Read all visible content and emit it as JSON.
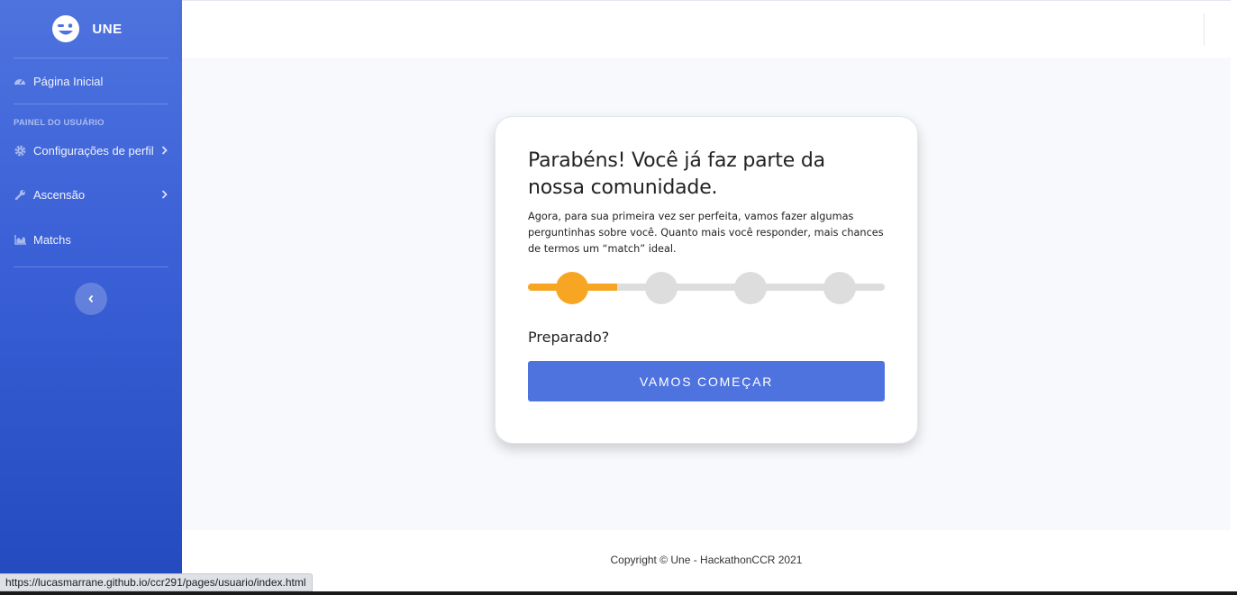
{
  "brand": {
    "name": "UNE",
    "logo_icon": "winking-face-icon"
  },
  "sidebar": {
    "home": {
      "label": "Página Inicial",
      "icon": "tachometer-icon"
    },
    "heading": "PAINEL DO USUÁRIO",
    "items": [
      {
        "label": "Configurações de perfil",
        "icon": "cog-icon",
        "has_submenu": true
      },
      {
        "label": "Ascensão",
        "icon": "wrench-icon",
        "has_submenu": true
      },
      {
        "label": "Matchs",
        "icon": "chart-area-icon",
        "has_submenu": false
      }
    ],
    "toggle_icon": "chevron-left-icon"
  },
  "card": {
    "title": "Parabéns! Você já faz parte da nossa comunidade.",
    "text": "Agora, para sua primeira vez ser perfeita, vamos fazer algumas perguntinhas sobre você. Quanto mais você responder, mais chances de termos um “match” ideal.",
    "progress": {
      "total_steps": 4,
      "current_step": 1,
      "fill_fraction": 0.25
    },
    "prompt": "Preparado?",
    "button_label": "VAMOS COMEÇAR"
  },
  "footer": {
    "copyright": "Copyright © Une - HackathonCCR 2021"
  },
  "status_bar": {
    "url": "https://lucasmarrane.github.io/ccr291/pages/usuario/index.html"
  },
  "colors": {
    "primary": "#4e73df",
    "accent": "#f6a623",
    "background": "#f8f9fc"
  }
}
